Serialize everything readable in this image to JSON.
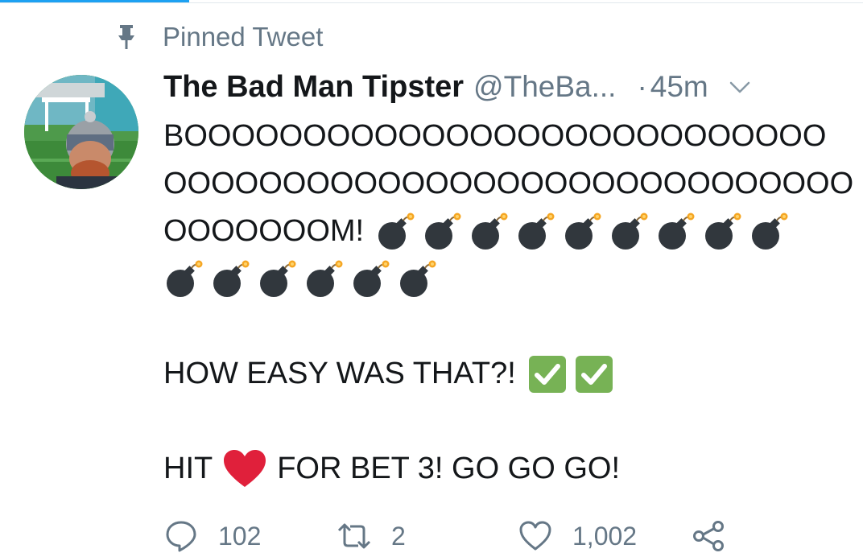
{
  "pinned": {
    "label": "Pinned Tweet",
    "icon": "pin-icon"
  },
  "tweet": {
    "display_name": "The Bad Man Tipster",
    "handle": "@TheBa...",
    "dot": "·",
    "time": "45m",
    "lines": {
      "l1": "BOOOOOOOOOOOOOOOOOOOOOOOOOOO",
      "l2": "OOOOOOOOOOOOOOOOOOOOOOOOOOOOO",
      "l3": "OOOOOOOM!",
      "l5": "HOW EASY WAS THAT?!",
      "l7a": "HIT",
      "l7b": "FOR BET 3! GO GO GO!"
    },
    "emoji": {
      "bomb_row1": 9,
      "bomb_row2": 6,
      "check_marks": 2
    }
  },
  "actions": {
    "reply_count": "102",
    "retweet_count": "2",
    "like_count": "1,002"
  },
  "colors": {
    "accent": "#1da1f2",
    "secondary_text": "#657786",
    "heart": "#e0203b",
    "check": "#77b255",
    "bomb": "#31373d"
  }
}
